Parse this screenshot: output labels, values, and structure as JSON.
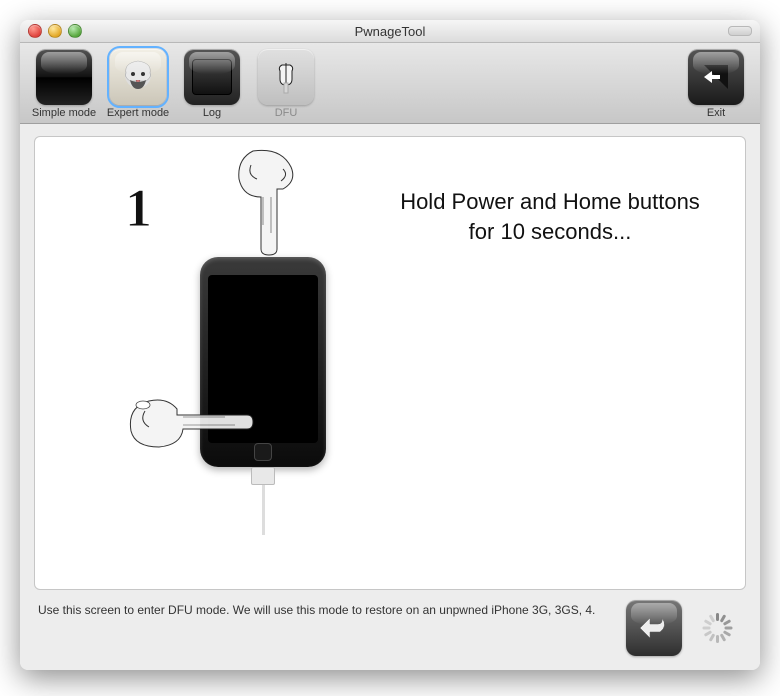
{
  "window": {
    "title": "PwnageTool"
  },
  "toolbar": {
    "simple": "Simple mode",
    "expert": "Expert mode",
    "log": "Log",
    "dfu": "DFU",
    "exit": "Exit"
  },
  "dfu": {
    "step_number": "1",
    "instruction": "Hold Power and Home buttons for 10 seconds...",
    "footer": "Use this screen to enter DFU mode. We will use this mode to restore on an unpwned iPhone 3G, 3GS, 4."
  },
  "icons": {
    "back": "back-arrow",
    "spinner": "activity-indicator"
  },
  "colors": {
    "selection": "#63b2ff"
  }
}
